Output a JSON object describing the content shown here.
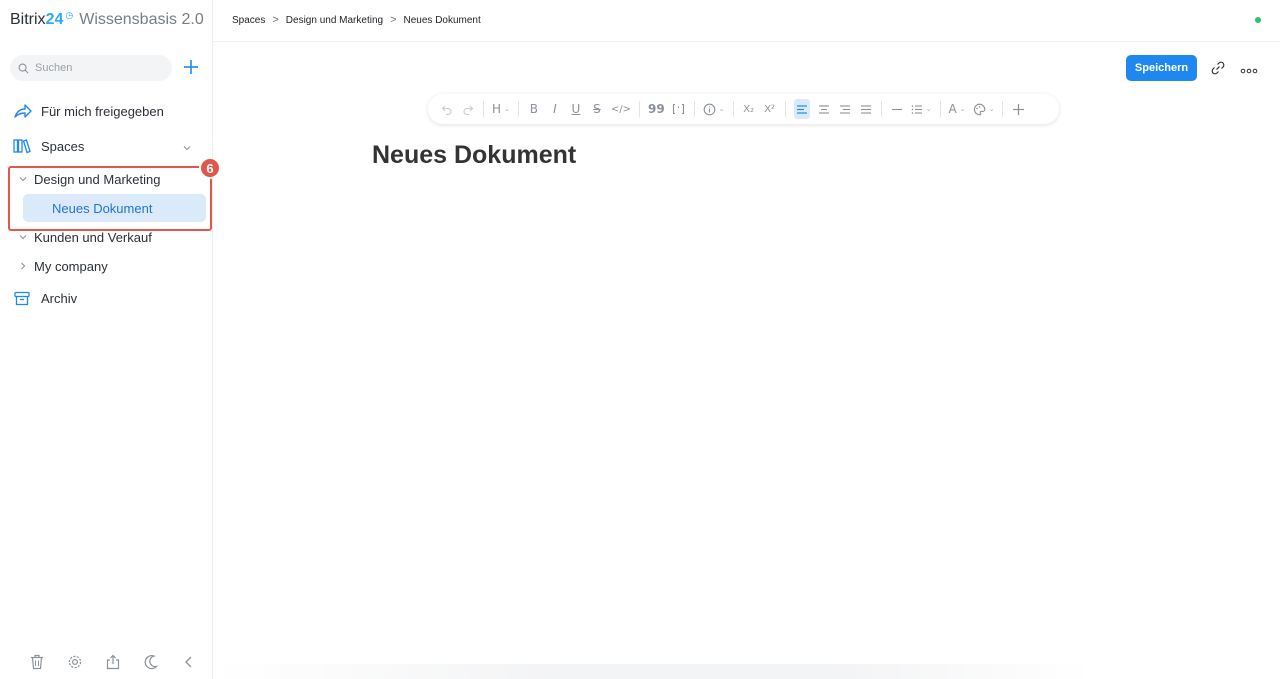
{
  "brand": {
    "name": "Bitrix",
    "number": "24",
    "clock_glyph": "◷",
    "product": "Wissensbasis 2.0"
  },
  "sidebar": {
    "search_placeholder": "Suchen",
    "items": [
      {
        "label": "Für mich freigegeben",
        "icon": "share-arrow-icon"
      },
      {
        "label": "Spaces",
        "icon": "books-icon"
      }
    ],
    "tree": [
      {
        "label": "Design und Marketing",
        "expanded": true
      },
      {
        "label": "Neues Dokument",
        "selected": true
      },
      {
        "label": "Kunden und Verkauf",
        "expanded": true
      },
      {
        "label": "My company",
        "expanded": false
      }
    ],
    "archive_label": "Archiv",
    "bottom_icons": [
      "trash-icon",
      "gear-icon",
      "share-upload-icon",
      "moon-icon",
      "collapse-left-icon"
    ]
  },
  "highlight": {
    "badge": "6",
    "color": "#e2574c"
  },
  "header": {
    "breadcrumb": [
      "Spaces",
      "Design und Marketing",
      "Neues Dokument"
    ],
    "separator": ">",
    "save_label": "Speichern",
    "status_color": "#2fc26b"
  },
  "toolbar": {
    "heading_label": "H",
    "bold": "B",
    "italic": "I",
    "underline": "U",
    "strike": "S",
    "code": "</>",
    "quote": "99",
    "subscript": "X₂",
    "superscript": "X²",
    "text_color": "A"
  },
  "document": {
    "title": "Neues Dokument"
  },
  "colors": {
    "accent": "#1f88f0",
    "selected_bg": "#dbeafb",
    "selected_text": "#1f76d2"
  }
}
